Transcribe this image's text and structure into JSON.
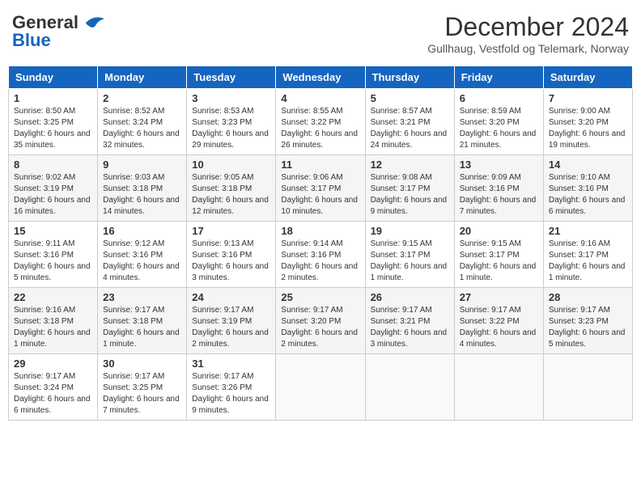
{
  "header": {
    "logo_line1": "General",
    "logo_line2": "Blue",
    "month_title": "December 2024",
    "subtitle": "Gullhaug, Vestfold og Telemark, Norway"
  },
  "days_of_week": [
    "Sunday",
    "Monday",
    "Tuesday",
    "Wednesday",
    "Thursday",
    "Friday",
    "Saturday"
  ],
  "weeks": [
    [
      {
        "day": "1",
        "sunrise": "8:50 AM",
        "sunset": "3:25 PM",
        "daylight": "6 hours and 35 minutes."
      },
      {
        "day": "2",
        "sunrise": "8:52 AM",
        "sunset": "3:24 PM",
        "daylight": "6 hours and 32 minutes."
      },
      {
        "day": "3",
        "sunrise": "8:53 AM",
        "sunset": "3:23 PM",
        "daylight": "6 hours and 29 minutes."
      },
      {
        "day": "4",
        "sunrise": "8:55 AM",
        "sunset": "3:22 PM",
        "daylight": "6 hours and 26 minutes."
      },
      {
        "day": "5",
        "sunrise": "8:57 AM",
        "sunset": "3:21 PM",
        "daylight": "6 hours and 24 minutes."
      },
      {
        "day": "6",
        "sunrise": "8:59 AM",
        "sunset": "3:20 PM",
        "daylight": "6 hours and 21 minutes."
      },
      {
        "day": "7",
        "sunrise": "9:00 AM",
        "sunset": "3:20 PM",
        "daylight": "6 hours and 19 minutes."
      }
    ],
    [
      {
        "day": "8",
        "sunrise": "9:02 AM",
        "sunset": "3:19 PM",
        "daylight": "6 hours and 16 minutes."
      },
      {
        "day": "9",
        "sunrise": "9:03 AM",
        "sunset": "3:18 PM",
        "daylight": "6 hours and 14 minutes."
      },
      {
        "day": "10",
        "sunrise": "9:05 AM",
        "sunset": "3:18 PM",
        "daylight": "6 hours and 12 minutes."
      },
      {
        "day": "11",
        "sunrise": "9:06 AM",
        "sunset": "3:17 PM",
        "daylight": "6 hours and 10 minutes."
      },
      {
        "day": "12",
        "sunrise": "9:08 AM",
        "sunset": "3:17 PM",
        "daylight": "6 hours and 9 minutes."
      },
      {
        "day": "13",
        "sunrise": "9:09 AM",
        "sunset": "3:16 PM",
        "daylight": "6 hours and 7 minutes."
      },
      {
        "day": "14",
        "sunrise": "9:10 AM",
        "sunset": "3:16 PM",
        "daylight": "6 hours and 6 minutes."
      }
    ],
    [
      {
        "day": "15",
        "sunrise": "9:11 AM",
        "sunset": "3:16 PM",
        "daylight": "6 hours and 5 minutes."
      },
      {
        "day": "16",
        "sunrise": "9:12 AM",
        "sunset": "3:16 PM",
        "daylight": "6 hours and 4 minutes."
      },
      {
        "day": "17",
        "sunrise": "9:13 AM",
        "sunset": "3:16 PM",
        "daylight": "6 hours and 3 minutes."
      },
      {
        "day": "18",
        "sunrise": "9:14 AM",
        "sunset": "3:16 PM",
        "daylight": "6 hours and 2 minutes."
      },
      {
        "day": "19",
        "sunrise": "9:15 AM",
        "sunset": "3:17 PM",
        "daylight": "6 hours and 1 minute."
      },
      {
        "day": "20",
        "sunrise": "9:15 AM",
        "sunset": "3:17 PM",
        "daylight": "6 hours and 1 minute."
      },
      {
        "day": "21",
        "sunrise": "9:16 AM",
        "sunset": "3:17 PM",
        "daylight": "6 hours and 1 minute."
      }
    ],
    [
      {
        "day": "22",
        "sunrise": "9:16 AM",
        "sunset": "3:18 PM",
        "daylight": "6 hours and 1 minute."
      },
      {
        "day": "23",
        "sunrise": "9:17 AM",
        "sunset": "3:18 PM",
        "daylight": "6 hours and 1 minute."
      },
      {
        "day": "24",
        "sunrise": "9:17 AM",
        "sunset": "3:19 PM",
        "daylight": "6 hours and 2 minutes."
      },
      {
        "day": "25",
        "sunrise": "9:17 AM",
        "sunset": "3:20 PM",
        "daylight": "6 hours and 2 minutes."
      },
      {
        "day": "26",
        "sunrise": "9:17 AM",
        "sunset": "3:21 PM",
        "daylight": "6 hours and 3 minutes."
      },
      {
        "day": "27",
        "sunrise": "9:17 AM",
        "sunset": "3:22 PM",
        "daylight": "6 hours and 4 minutes."
      },
      {
        "day": "28",
        "sunrise": "9:17 AM",
        "sunset": "3:23 PM",
        "daylight": "6 hours and 5 minutes."
      }
    ],
    [
      {
        "day": "29",
        "sunrise": "9:17 AM",
        "sunset": "3:24 PM",
        "daylight": "6 hours and 6 minutes."
      },
      {
        "day": "30",
        "sunrise": "9:17 AM",
        "sunset": "3:25 PM",
        "daylight": "6 hours and 7 minutes."
      },
      {
        "day": "31",
        "sunrise": "9:17 AM",
        "sunset": "3:26 PM",
        "daylight": "6 hours and 9 minutes."
      },
      null,
      null,
      null,
      null
    ]
  ]
}
